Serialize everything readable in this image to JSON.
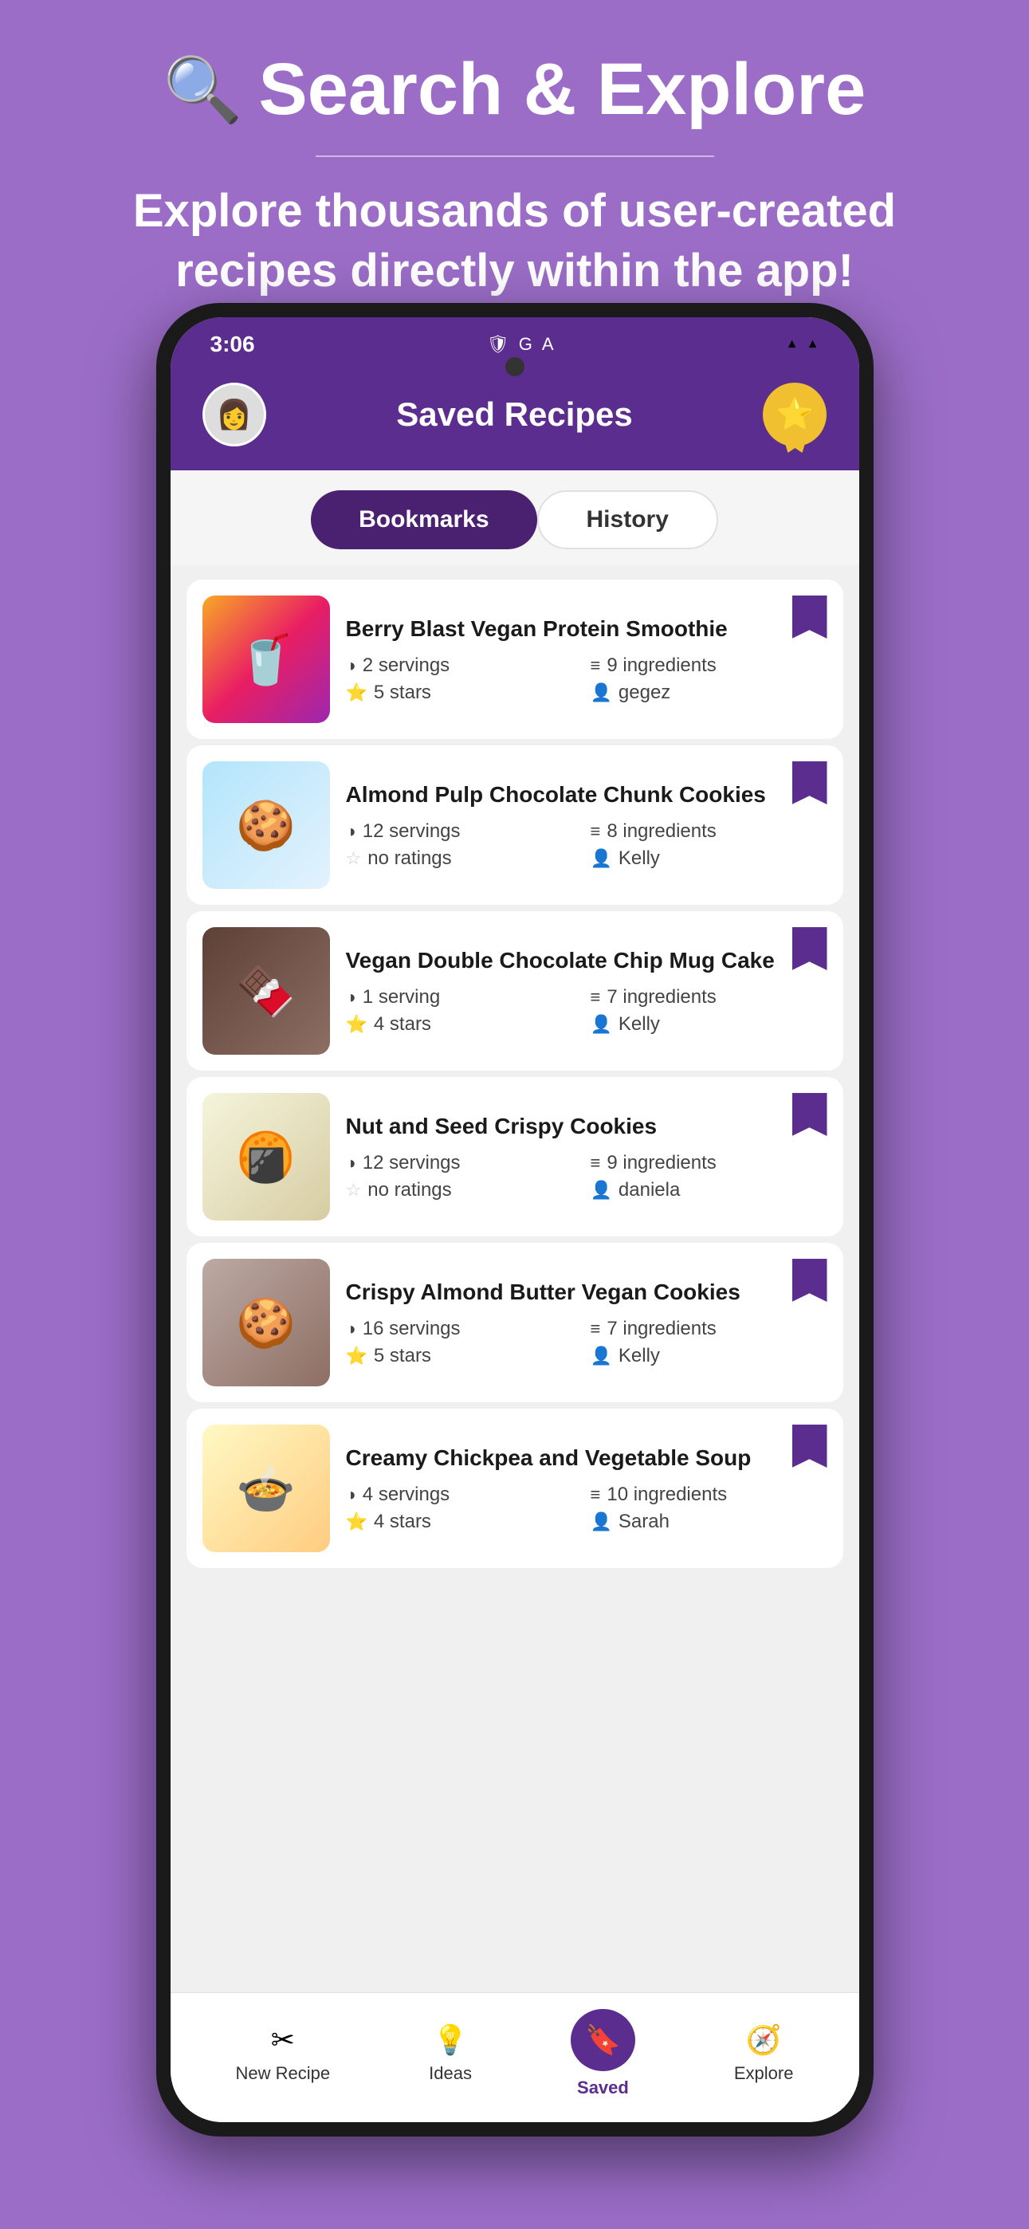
{
  "hero": {
    "title": "Search & Explore",
    "subtitle": "Explore thousands of user-created recipes directly within the app!",
    "magnifier": "🔍"
  },
  "status_bar": {
    "time": "3:06",
    "icons_left": [
      "🛡",
      "G",
      "A"
    ],
    "wifi": "▲",
    "signal": "▲"
  },
  "header": {
    "title": "Saved Recipes",
    "avatar_emoji": "👩"
  },
  "tabs": [
    {
      "label": "Bookmarks",
      "active": true
    },
    {
      "label": "History",
      "active": false
    }
  ],
  "recipes": [
    {
      "name": "Berry Blast Vegan Protein Smoothie",
      "servings": "2 servings",
      "ingredients": "9 ingredients",
      "rating": "5 stars",
      "has_rating": true,
      "author": "gegez",
      "img_class": "smoothie",
      "img_emoji": "🥤"
    },
    {
      "name": "Almond Pulp Chocolate Chunk Cookies",
      "servings": "12 servings",
      "ingredients": "8 ingredients",
      "rating": "no ratings",
      "has_rating": false,
      "author": "Kelly",
      "img_class": "cookies",
      "img_emoji": "🍪"
    },
    {
      "name": "Vegan Double Chocolate Chip Mug Cake",
      "servings": "1 serving",
      "ingredients": "7 ingredients",
      "rating": "4 stars",
      "has_rating": true,
      "author": "Kelly",
      "img_class": "mug-cake",
      "img_emoji": "🍫"
    },
    {
      "name": "Nut and Seed Crispy Cookies",
      "servings": "12 servings",
      "ingredients": "9 ingredients",
      "rating": "no ratings",
      "has_rating": false,
      "author": "daniela",
      "img_class": "crispy",
      "img_emoji": "🍘"
    },
    {
      "name": "Crispy Almond Butter Vegan Cookies",
      "servings": "16 servings",
      "ingredients": "7 ingredients",
      "rating": "5 stars",
      "has_rating": true,
      "author": "Kelly",
      "img_class": "butter-cookies",
      "img_emoji": "🍪"
    },
    {
      "name": "Creamy Chickpea and Vegetable Soup",
      "servings": "4 servings",
      "ingredients": "10 ingredients",
      "rating": "4 stars",
      "has_rating": true,
      "author": "Sarah",
      "img_class": "soup",
      "img_emoji": "🍲"
    }
  ],
  "bottom_nav": [
    {
      "label": "New Recipe",
      "icon": "✂",
      "active": false
    },
    {
      "label": "Ideas",
      "icon": "💡",
      "active": false
    },
    {
      "label": "Saved",
      "icon": "🔖",
      "active": true
    },
    {
      "label": "Explore",
      "icon": "🧭",
      "active": false
    }
  ]
}
